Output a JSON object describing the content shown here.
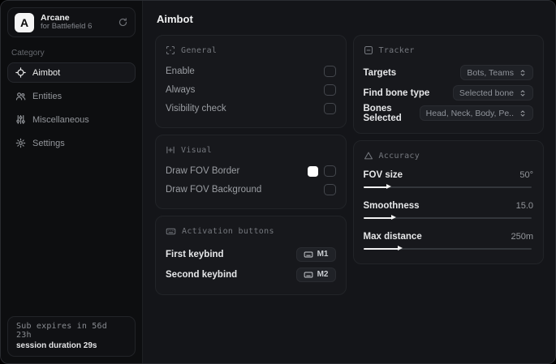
{
  "sidebar": {
    "app": {
      "logo_letter": "A",
      "name": "Arcane",
      "subtitle": "for Battlefield 6"
    },
    "category_label": "Category",
    "items": [
      {
        "label": "Aimbot"
      },
      {
        "label": "Entities"
      },
      {
        "label": "Miscellaneous"
      },
      {
        "label": "Settings"
      }
    ],
    "subscription": {
      "expires": "Sub expires in 56d 23h",
      "session": "session duration 29s"
    }
  },
  "main": {
    "title": "Aimbot",
    "general": {
      "title": "General",
      "rows": [
        {
          "label": "Enable",
          "checked": false
        },
        {
          "label": "Always",
          "checked": false
        },
        {
          "label": "Visibility check",
          "checked": false
        }
      ]
    },
    "visual": {
      "title": "Visual",
      "rows": [
        {
          "label": "Draw FOV Border",
          "color": "#ffffff",
          "checked": false
        },
        {
          "label": "Draw FOV Background",
          "checked": false
        }
      ]
    },
    "activation": {
      "title": "Activation buttons",
      "rows": [
        {
          "label": "First keybind",
          "key": "M1"
        },
        {
          "label": "Second keybind",
          "key": "M2"
        }
      ]
    },
    "tracker": {
      "title": "Tracker",
      "rows": [
        {
          "label": "Targets",
          "value": "Bots, Teams"
        },
        {
          "label": "Find bone type",
          "value": "Selected bone"
        },
        {
          "label": "Bones Selected",
          "value": "Head, Neck, Body, Pe.."
        }
      ]
    },
    "accuracy": {
      "title": "Accuracy",
      "rows": [
        {
          "label": "FOV size",
          "value": "50°",
          "percent": 14
        },
        {
          "label": "Smoothness",
          "value": "15.0",
          "percent": 17
        },
        {
          "label": "Max distance",
          "value": "250m",
          "percent": 21
        }
      ]
    }
  }
}
